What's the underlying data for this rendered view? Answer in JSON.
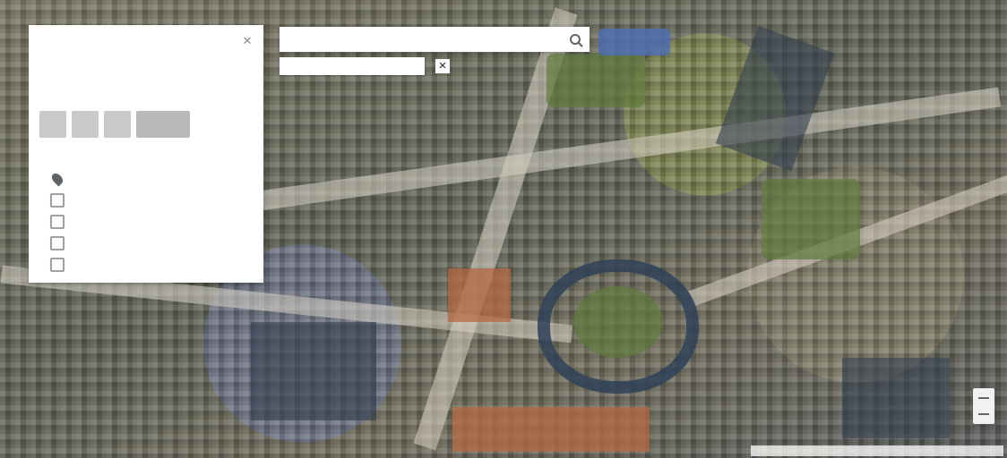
{
  "panel": {
    "title": "",
    "close_icon": "close-icon",
    "section_title": "",
    "layers": [
      {
        "icon": "pin-icon",
        "label": ""
      },
      {
        "icon": "layer-icon",
        "label": ""
      },
      {
        "icon": "layer-icon",
        "label": ""
      },
      {
        "icon": "layer-icon",
        "label": ""
      },
      {
        "icon": "layer-icon",
        "label": ""
      }
    ],
    "footer": ""
  },
  "search": {
    "value": "",
    "placeholder": "",
    "icon": "search-icon"
  },
  "chip": {
    "label": "",
    "close_icon": "close-icon"
  },
  "map": {
    "attribution": ""
  },
  "colors": {
    "panel_bg": "#ffffff",
    "pitch_blue": "#4f6fb0"
  }
}
